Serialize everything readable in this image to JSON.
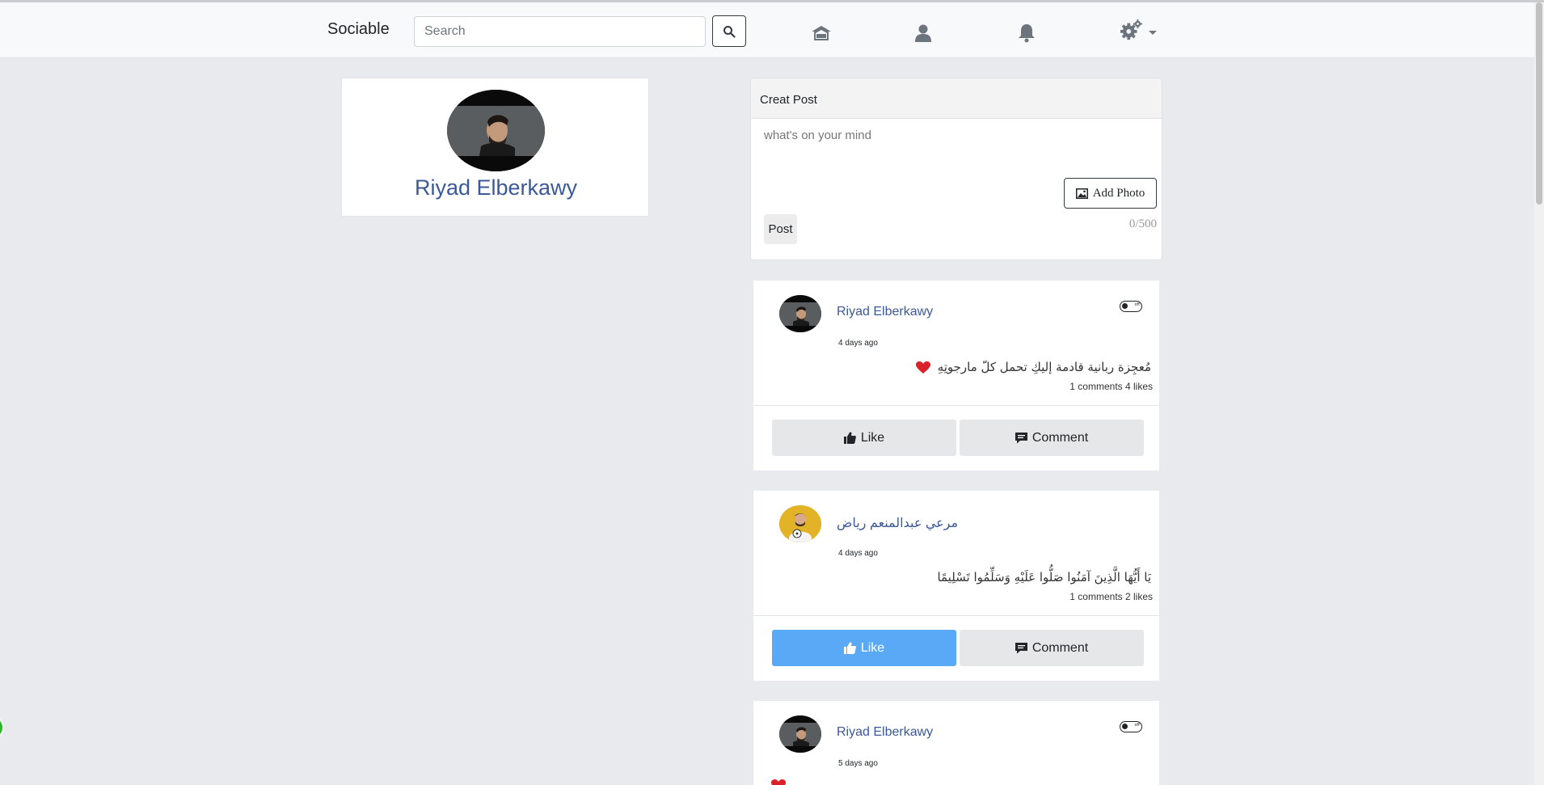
{
  "navbar": {
    "brand": "Sociable",
    "search_placeholder": "Search",
    "icons": [
      "search-icon",
      "home-icon",
      "user-icon",
      "bell-icon",
      "gears-icon"
    ]
  },
  "profile": {
    "name": "Riyad Elberkawy"
  },
  "create_post": {
    "title": "Creat Post",
    "placeholder": "what's on your mind",
    "add_photo_label": "Add Photo",
    "post_label": "Post",
    "counter": "0/500"
  },
  "posts": [
    {
      "author": "Riyad Elberkawy",
      "time": "4 days ago",
      "content": "مُعجِزة ربانية قادمة إليكِ تحمل كلّ مارجوتِهِ",
      "meta": "1 comments 4 likes",
      "like_label": "Like",
      "comment_label": "Comment",
      "liked": false,
      "has_toggle": true
    },
    {
      "author": "مرعي عبدالمنعم رياض",
      "time": "4 days ago",
      "content": "يَا أَيُّهَا الَّذِينَ آمَنُوا صَلُّوا عَلَيْهِ وَسَلِّمُوا تَسْلِيمًا",
      "meta": "1 comments 2 likes",
      "like_label": "Like",
      "comment_label": "Comment",
      "liked": true,
      "has_toggle": false
    },
    {
      "author": "Riyad Elberkawy",
      "time": "5 days ago",
      "has_toggle": true
    }
  ],
  "colors": {
    "page_bg": "#e9eaed",
    "link": "#3b5998",
    "like_active": "#5aa9f7"
  }
}
